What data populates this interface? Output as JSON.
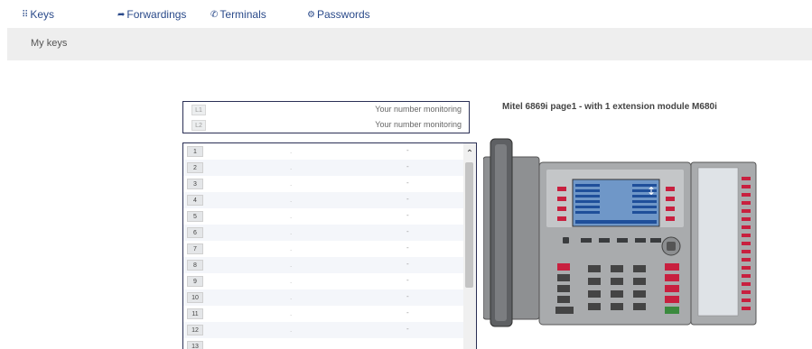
{
  "nav": {
    "keys": "Keys",
    "forwardings": "Forwardings",
    "terminals": "Terminals",
    "passwords": "Passwords"
  },
  "subnav": {
    "title": "My keys"
  },
  "lines": [
    {
      "badge": "L1",
      "text": "Your number monitoring"
    },
    {
      "badge": "L2",
      "text": "Your number monitoring"
    }
  ],
  "keys": [
    {
      "num": "1",
      "mid": ".",
      "value": "-"
    },
    {
      "num": "2",
      "mid": ".",
      "value": "-"
    },
    {
      "num": "3",
      "mid": ".",
      "value": "-"
    },
    {
      "num": "4",
      "mid": ".",
      "value": "-"
    },
    {
      "num": "5",
      "mid": ".",
      "value": "-"
    },
    {
      "num": "6",
      "mid": ".",
      "value": "-"
    },
    {
      "num": "7",
      "mid": ".",
      "value": "-"
    },
    {
      "num": "8",
      "mid": ".",
      "value": "-"
    },
    {
      "num": "9",
      "mid": ".",
      "value": "-"
    },
    {
      "num": "10",
      "mid": ".",
      "value": "-"
    },
    {
      "num": "11",
      "mid": ".",
      "value": "-"
    },
    {
      "num": "12",
      "mid": ".",
      "value": "-"
    },
    {
      "num": "13",
      "mid": "",
      "value": ""
    }
  ],
  "phone": {
    "title": "Mitel 6869i page1 - with 1 extension module M680i"
  },
  "colors": {
    "nav_link": "#2a4a8a",
    "key_red": "#c8203f",
    "screen_blue": "#1f4f9a",
    "border_navy": "#2a2f55"
  }
}
